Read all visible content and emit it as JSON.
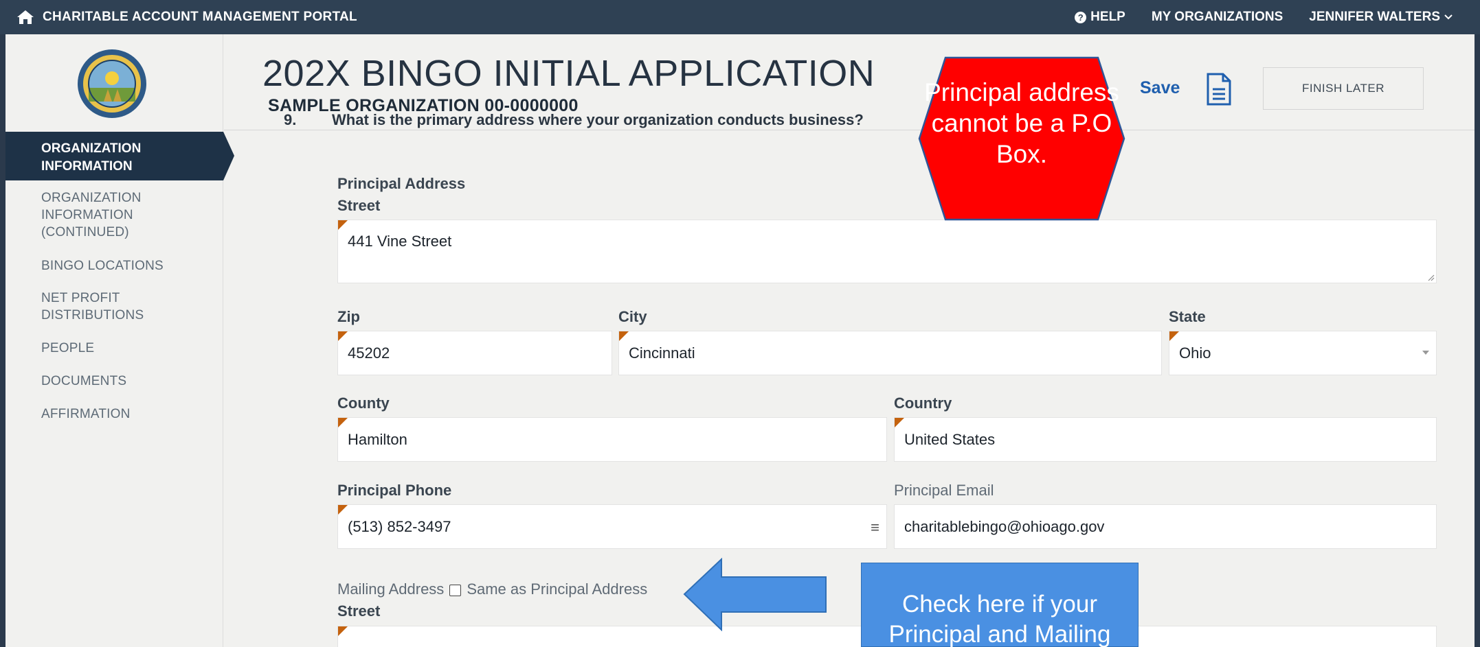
{
  "topbar": {
    "portal_title": "CHARITABLE ACCOUNT MANAGEMENT PORTAL",
    "help": "HELP",
    "my_orgs": "MY ORGANIZATIONS",
    "user": "JENNIFER WALTERS"
  },
  "sidebar": {
    "active": "ORGANIZATION INFORMATION",
    "items": [
      "ORGANIZATION INFORMATION (CONTINUED)",
      "BINGO LOCATIONS",
      "NET PROFIT DISTRIBUTIONS",
      "PEOPLE",
      "DOCUMENTS",
      "AFFIRMATION"
    ]
  },
  "header": {
    "title": "202X BINGO INITIAL APPLICATION",
    "org": "SAMPLE ORGANIZATION 00-0000000",
    "save": "Save",
    "finish_later": "FINISH LATER"
  },
  "form": {
    "question_number": "9.",
    "question": "What is the primary address where your organization conducts business?",
    "principal_address_label": "Principal Address",
    "street_label": "Street",
    "street_value": "441 Vine Street",
    "zip_label": "Zip",
    "zip_value": "45202",
    "city_label": "City",
    "city_value": "Cincinnati",
    "state_label": "State",
    "state_value": "Ohio",
    "county_label": "County",
    "county_value": "Hamilton",
    "country_label": "Country",
    "country_value": "United States",
    "phone_label": "Principal Phone",
    "phone_value": "(513) 852-3497",
    "email_label": "Principal Email",
    "email_value": "charitablebingo@ohioago.gov",
    "mailing_label": "Mailing Address",
    "same_as_label": "Same as Principal Address",
    "mailing_street_label": "Street"
  },
  "annotations": {
    "hex_text": "Principal address cannot be a P.O Box.",
    "box_text": "Check here if your Principal and Mailing"
  },
  "colors": {
    "topbar": "#2f4154",
    "nav_active": "#1e3247",
    "accent": "#1f5fae",
    "required_marker": "#c4620e",
    "callout_red": "#ff0000",
    "callout_blue": "#4a90e2"
  }
}
